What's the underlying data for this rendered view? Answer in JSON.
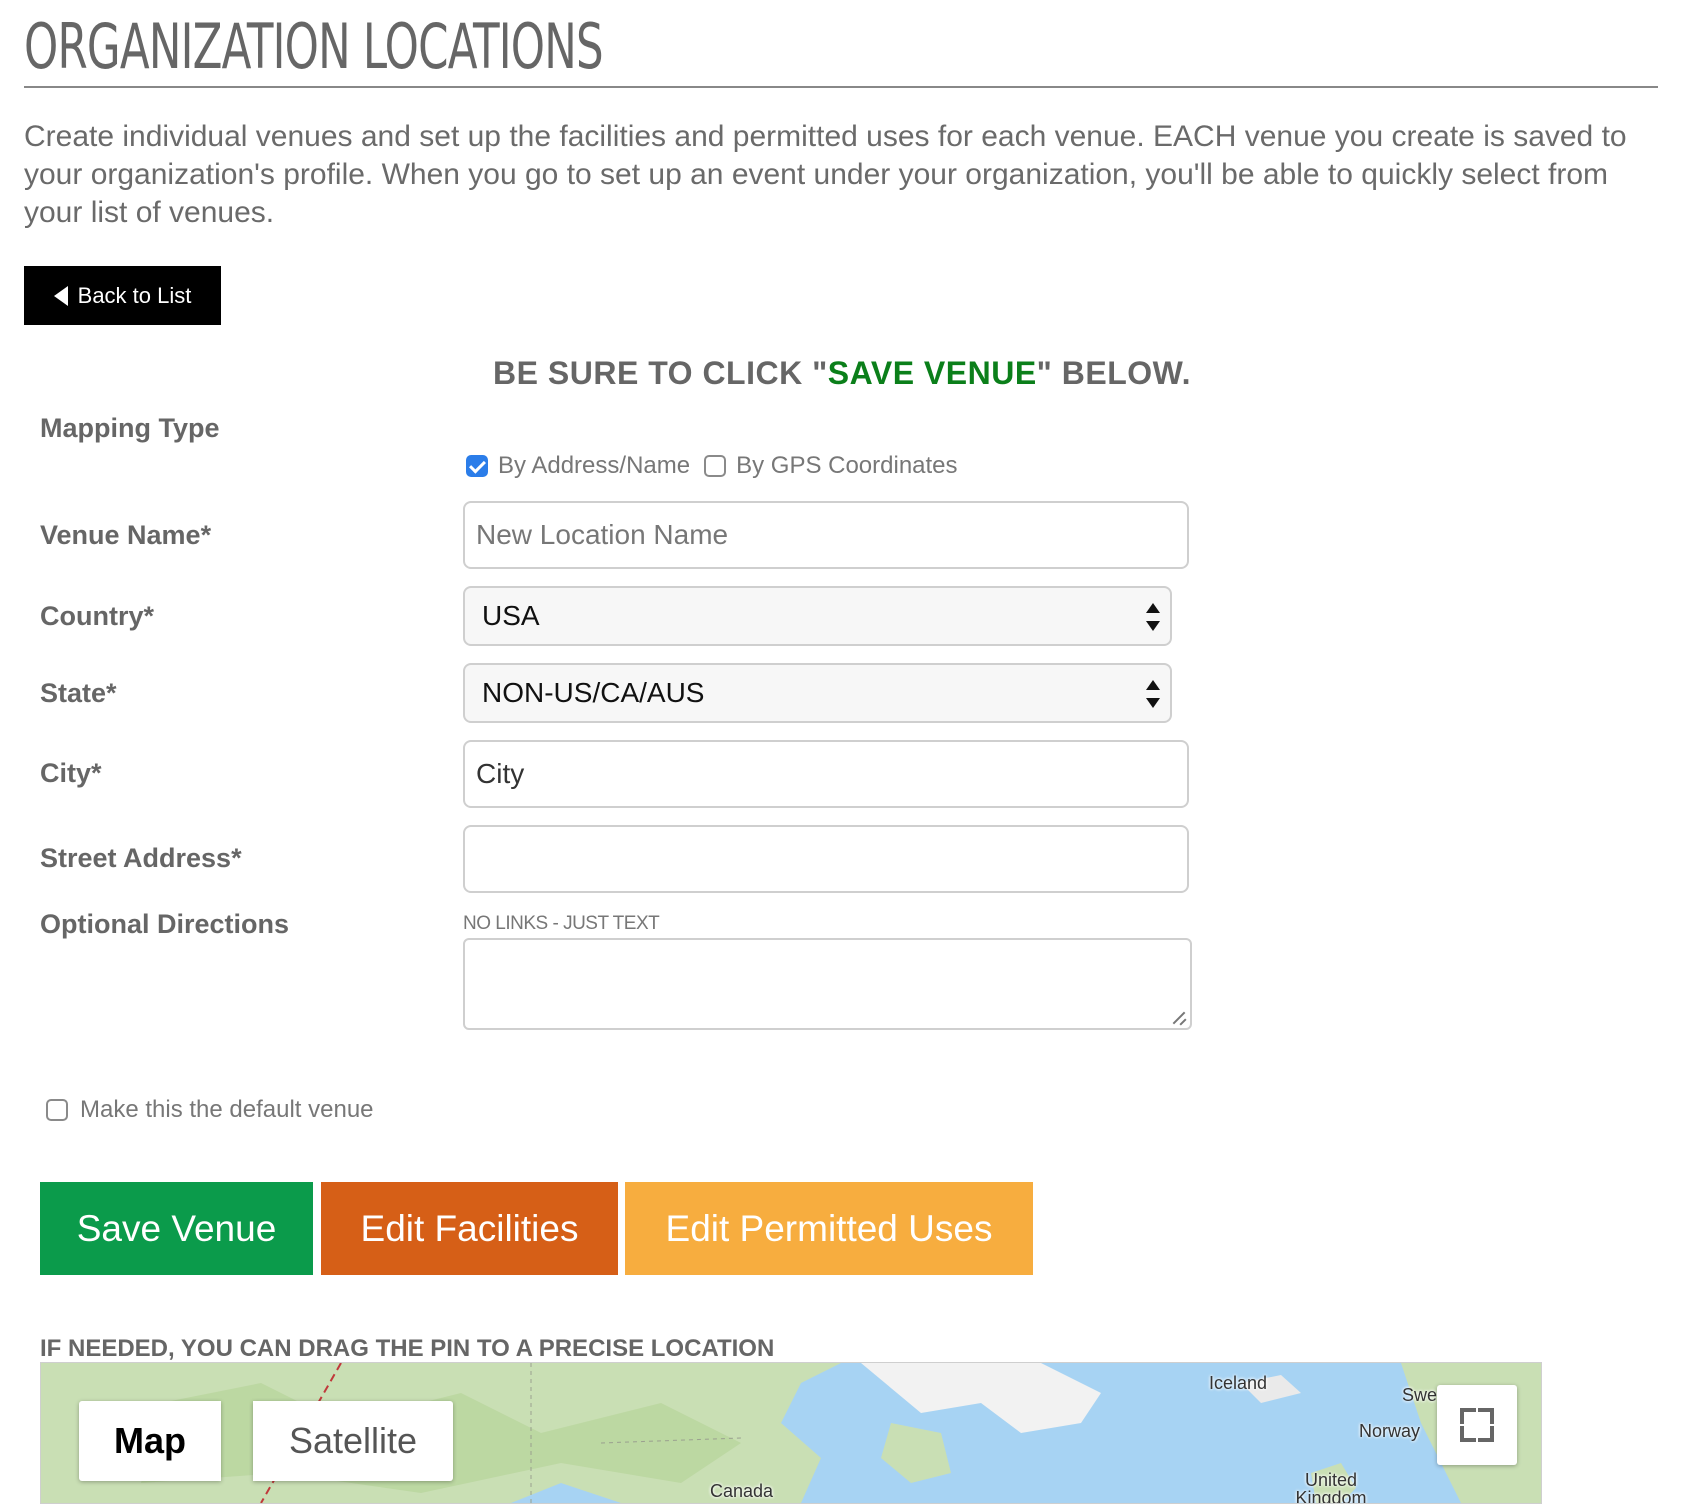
{
  "page": {
    "title": "ORGANIZATION LOCATIONS",
    "intro": "Create individual venues and set up the facilities and permitted uses for each venue. EACH venue you create is saved to your organization's profile. When you go to set up an event under your organization, you'll be able to quickly select from your list of venues."
  },
  "back_button": {
    "label": "Back to List"
  },
  "notice": {
    "before": "BE SURE TO CLICK \"",
    "highlight": "SAVE VENUE",
    "after": "\" BELOW.",
    "highlight_color": "#0b7f1a"
  },
  "form": {
    "mapping_type": {
      "label": "Mapping Type",
      "options": [
        {
          "label": "By Address/Name",
          "checked": true
        },
        {
          "label": "By GPS Coordinates",
          "checked": false
        }
      ]
    },
    "venue_name": {
      "label": "Venue Name*",
      "placeholder": "New Location Name",
      "value": ""
    },
    "country": {
      "label": "Country*",
      "selected": "USA"
    },
    "state": {
      "label": "State*",
      "selected": "NON-US/CA/AUS"
    },
    "city": {
      "label": "City*",
      "value": "City"
    },
    "street_address": {
      "label": "Street Address*",
      "value": ""
    },
    "optional_directions": {
      "label": "Optional Directions",
      "hint": "NO LINKS - JUST TEXT",
      "value": ""
    },
    "default_venue": {
      "label": "Make this the default venue",
      "checked": false
    }
  },
  "actions": {
    "save": {
      "label": "Save Venue",
      "color": "#0b9b4b"
    },
    "facilities": {
      "label": "Edit Facilities",
      "color": "#d65f17"
    },
    "permitted_uses": {
      "label": "Edit Permitted Uses",
      "color": "#f7ad3f"
    }
  },
  "map": {
    "instruction": "IF NEEDED, YOU CAN DRAG THE PIN TO A PRECISE LOCATION",
    "tabs": {
      "map": "Map",
      "satellite": "Satellite"
    },
    "active_tab": "Map",
    "places": {
      "iceland": "Iceland",
      "norway": "Norway",
      "uk": "United Kingdom",
      "canada": "Canada",
      "sweden": "Swe"
    },
    "fullscreen_icon": "fullscreen-icon"
  }
}
